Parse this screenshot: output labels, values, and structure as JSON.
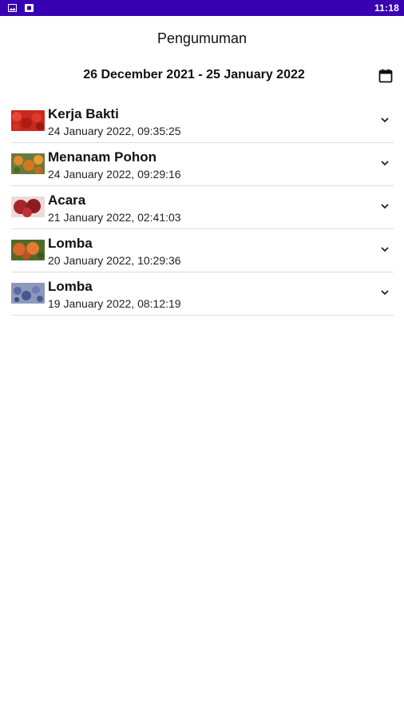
{
  "status_bar": {
    "time": "11:18",
    "color": "#3700b3",
    "icons": [
      "gallery-icon",
      "notification-icon"
    ]
  },
  "header": {
    "title": "Pengumuman"
  },
  "filter": {
    "date_range": "26 December 2021 - 25 January 2022",
    "calendar_icon": "calendar-icon"
  },
  "announcements": [
    {
      "title": "Kerja Bakti",
      "datetime": "24 January 2022, 09:35:25",
      "thumb_color": "#c8291e",
      "icon": "chevron-down-icon"
    },
    {
      "title": "Menanam Pohon",
      "datetime": "24 January 2022, 09:29:16",
      "thumb_color": "#d4781e",
      "icon": "chevron-down-icon"
    },
    {
      "title": "Acara",
      "datetime": "21 January 2022, 02:41:03",
      "thumb_color": "#a8232b",
      "icon": "chevron-down-icon"
    },
    {
      "title": "Lomba",
      "datetime": "20 January 2022, 10:29:36",
      "thumb_color": "#d9652a",
      "icon": "chevron-down-icon"
    },
    {
      "title": "Lomba",
      "datetime": "19 January 2022, 08:12:19",
      "thumb_color": "#5a6aa8",
      "icon": "chevron-down-icon"
    }
  ]
}
